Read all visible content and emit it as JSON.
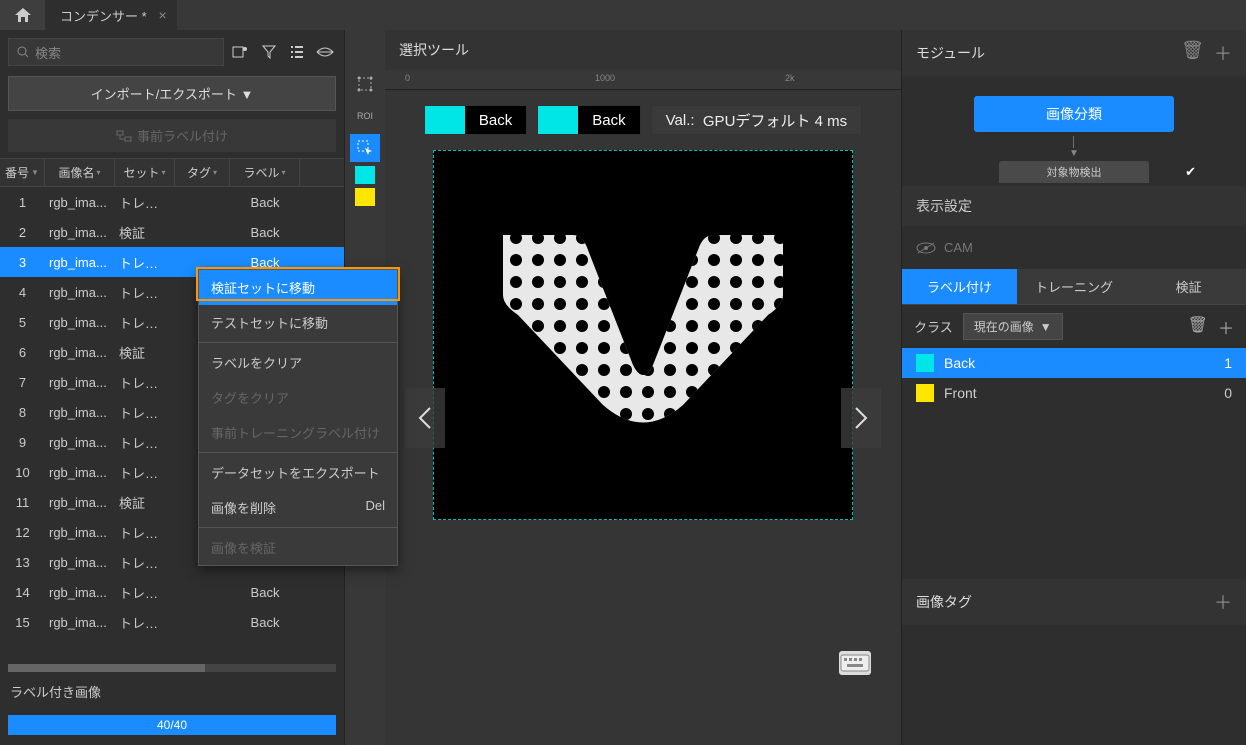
{
  "tabTitle": "コンデンサー *",
  "searchPlaceholder": "検索",
  "importExport": "インポート/エクスポート ▼",
  "preLabel": "事前ラベル付け",
  "columns": {
    "num": "番号",
    "name": "画像名",
    "set": "セット",
    "tag": "タグ",
    "label": "ラベル"
  },
  "rows": [
    {
      "n": "1",
      "name": "rgb_ima...",
      "set": "トレーニ...",
      "label": "Back"
    },
    {
      "n": "2",
      "name": "rgb_ima...",
      "set": "検証",
      "label": "Back"
    },
    {
      "n": "3",
      "name": "rgb_ima...",
      "set": "トレーニ...",
      "label": "Back"
    },
    {
      "n": "4",
      "name": "rgb_ima...",
      "set": "トレーニ...",
      "label": ""
    },
    {
      "n": "5",
      "name": "rgb_ima...",
      "set": "トレーニ...",
      "label": ""
    },
    {
      "n": "6",
      "name": "rgb_ima...",
      "set": "検証",
      "label": ""
    },
    {
      "n": "7",
      "name": "rgb_ima...",
      "set": "トレーニ...",
      "label": ""
    },
    {
      "n": "8",
      "name": "rgb_ima...",
      "set": "トレーニ...",
      "label": ""
    },
    {
      "n": "9",
      "name": "rgb_ima...",
      "set": "トレーニ...",
      "label": ""
    },
    {
      "n": "10",
      "name": "rgb_ima...",
      "set": "トレーニ...",
      "label": ""
    },
    {
      "n": "11",
      "name": "rgb_ima...",
      "set": "検証",
      "label": ""
    },
    {
      "n": "12",
      "name": "rgb_ima...",
      "set": "トレーニ...",
      "label": ""
    },
    {
      "n": "13",
      "name": "rgb_ima...",
      "set": "トレーニ...",
      "label": ""
    },
    {
      "n": "14",
      "name": "rgb_ima...",
      "set": "トレーニ...",
      "label": "Back"
    },
    {
      "n": "15",
      "name": "rgb_ima...",
      "set": "トレーニ...",
      "label": "Back"
    }
  ],
  "selectedRow": 2,
  "labeledImages": "ラベル付き画像",
  "progressText": "40/40",
  "centerTitle": "選択ツール",
  "rulerTicks": [
    "0",
    "1000",
    "2k"
  ],
  "chip1": "Back",
  "chip2": "Back",
  "valLabel": "Val.:",
  "valText": "GPUデフォルト 4 ms",
  "roiLabel": "ROI",
  "rightPanel": {
    "moduleTitle": "モジュール",
    "moduleNode": "画像分類",
    "moduleSub": "対象物検出",
    "displaySettings": "表示設定",
    "cam": "CAM",
    "tabs": {
      "label": "ラベル付け",
      "train": "トレーニング",
      "val": "検証"
    },
    "classLabel": "クラス",
    "classSelect": "現在の画像",
    "classes": [
      {
        "name": "Back",
        "count": "1",
        "color": "#00e5e5"
      },
      {
        "name": "Front",
        "count": "0",
        "color": "#ffe600"
      }
    ],
    "imageTag": "画像タグ"
  },
  "contextMenu": {
    "moveVal": "検証セットに移動",
    "moveTest": "テストセットに移動",
    "clearLabel": "ラベルをクリア",
    "clearTag": "タグをクリア",
    "preTrain": "事前トレーニングラベル付け",
    "exportDS": "データセットをエクスポート",
    "deleteImg": "画像を削除",
    "deleteShortcut": "Del",
    "verifyImg": "画像を検証"
  }
}
